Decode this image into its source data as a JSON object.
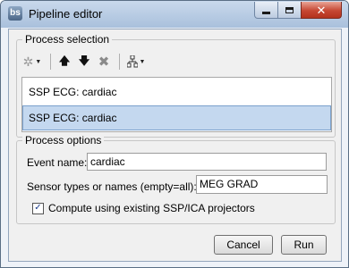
{
  "window": {
    "title": "Pipeline editor",
    "app_icon_text": "bs"
  },
  "process_selection": {
    "group_title": "Process selection",
    "toolbar": [
      "gear-icon",
      "arrow-up-icon",
      "arrow-down-icon",
      "delete-icon",
      "tree-icon"
    ],
    "items": [
      {
        "label": "SSP ECG: cardiac",
        "selected": false
      },
      {
        "label": "SSP ECG: cardiac",
        "selected": true
      }
    ]
  },
  "process_options": {
    "group_title": "Process options",
    "event_name": {
      "label": "Event name:",
      "value": "cardiac"
    },
    "sensor_types": {
      "label": "Sensor types or names (empty=all):",
      "value": "MEG GRAD"
    },
    "compute_checkbox": {
      "label": "Compute using existing SSP/ICA projectors",
      "checked": true
    }
  },
  "buttons": {
    "cancel": "Cancel",
    "run": "Run"
  },
  "colors": {
    "selection": "#c4d8ef",
    "titlebar": "#b8cce4",
    "close_button": "#c64733"
  }
}
